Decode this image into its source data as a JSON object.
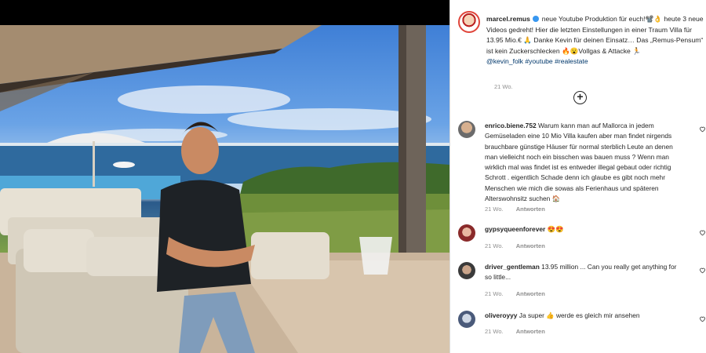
{
  "post": {
    "username": "marcel.remus",
    "caption_text": "neue Youtube Produktion für euch!📽️👌 heute 3 neue Videos gedreht! Hier die letzten Einstellungen in einer Traum Villa für 13.95 Mio.€ 🙏 Danke Kevin für deinen Einsatz… Das „Remus-Pensum“ ist kein Zuckerschlecken 🔥😮Vollgas & Attacke 🏃",
    "mentions": "@kevin_folk #youtube #realestate",
    "time": "21 Wo."
  },
  "add_comment_icon": "plus-circle-icon",
  "comments": [
    {
      "username": "enrico.biene.752",
      "text": "Warum kann man auf Mallorca in jedem Gemüseladen eine 10 Mio Villa kaufen aber man findet nirgends brauchbare günstige Häuser für normal sterblich Leute an denen man vielleicht noch ein bisschen was bauen muss ? Wenn man wirklich mal was findet ist es entweder illegal gebaut oder richtig Schrott . eigentlich Schade denn ich glaube es gibt noch mehr Menschen wie mich die sowas als Ferienhaus und späteren Alterswohnsitz suchen 🏠",
      "time": "21 Wo.",
      "reply": "Antworten"
    },
    {
      "username": "gypsyqueenforever",
      "text": "😍😍",
      "time": "21 Wo.",
      "reply": "Antworten"
    },
    {
      "username": "driver_gentleman",
      "text": "13.95 million ... Can you really get anything for so little...",
      "time": "21 Wo.",
      "reply": "Antworten"
    },
    {
      "username": "oliveroyyy",
      "text": "Ja super 👍 werde es gleich mir ansehen",
      "time": "21 Wo.",
      "reply": "Antworten"
    }
  ],
  "colors": {
    "link": "#00376b",
    "meta": "#8e8e8e",
    "verified": "#3897f0"
  }
}
